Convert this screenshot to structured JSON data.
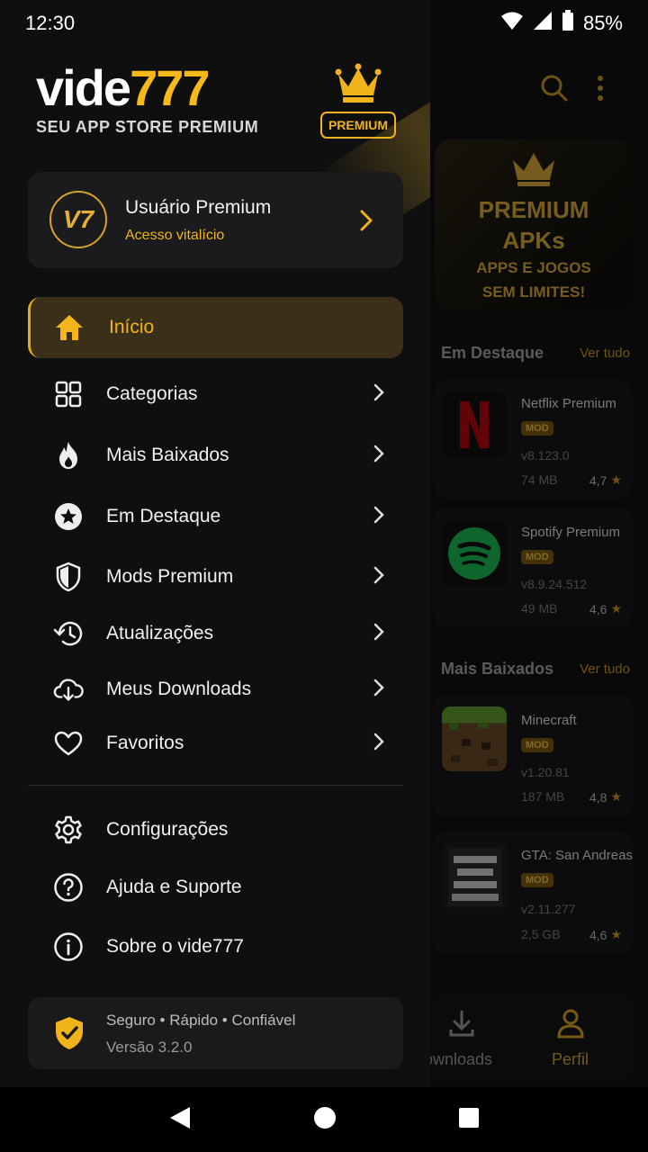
{
  "status": {
    "time": "12:30",
    "battery": "85%"
  },
  "drawer": {
    "logo_white": "vide",
    "logo_gold": "777",
    "tagline": "SEU APP STORE PREMIUM",
    "premium_badge": "PREMIUM",
    "user": {
      "avatar_text": "V7",
      "name": "Usuário Premium",
      "subtitle": "Acesso vitalício"
    },
    "menu": [
      {
        "label": "Início",
        "icon": "home-icon",
        "active": true
      },
      {
        "label": "Categorias",
        "icon": "grid-icon"
      },
      {
        "label": "Mais Baixados",
        "icon": "fire-icon"
      },
      {
        "label": "Em Destaque",
        "icon": "star-badge-icon"
      },
      {
        "label": "Mods Premium",
        "icon": "shield-icon"
      },
      {
        "label": "Atualizações",
        "icon": "history-icon"
      },
      {
        "label": "Meus Downloads",
        "icon": "cloud-download-icon"
      },
      {
        "label": "Favoritos",
        "icon": "heart-icon"
      }
    ],
    "secondary": [
      {
        "label": "Configurações",
        "icon": "gear-icon"
      },
      {
        "label": "Ajuda e Suporte",
        "icon": "help-icon"
      },
      {
        "label": "Sobre o vide777",
        "icon": "info-icon"
      }
    ],
    "footer": {
      "line1": "Seguro • Rápido • Confiável",
      "line2": "Versão 3.2.0"
    }
  },
  "background": {
    "banner": {
      "line1": "PREMIUM",
      "line2": "APKs",
      "line3": "APPS E JOGOS",
      "line4": "SEM LIMITES!"
    },
    "section1": {
      "title": "Em Destaque",
      "link": "Ver tudo"
    },
    "section2": {
      "title": "Mais Baixados",
      "link": "Ver tudo"
    },
    "cards": [
      {
        "name": "Netflix Premium",
        "badge": "MOD",
        "version": "v8.123.0",
        "size": "74 MB",
        "rating": "4,7"
      },
      {
        "name": "Spotify Premium",
        "badge": "MOD",
        "version": "v8.9.24.512",
        "size": "49 MB",
        "rating": "4,6"
      },
      {
        "name": "Minecraft",
        "badge": "MOD",
        "version": "v1.20.81",
        "size": "187 MB",
        "rating": "4,8"
      },
      {
        "name": "GTA: San Andreas",
        "badge": "MOD",
        "version": "v2.11.277",
        "size": "2,5 GB",
        "rating": "4,6"
      }
    ],
    "bottom_nav": {
      "downloads": "Downloads",
      "profile": "Perfil"
    }
  },
  "colors": {
    "accent": "#f5b918",
    "bg": "#0f0f10",
    "card": "#1b1b1d"
  }
}
